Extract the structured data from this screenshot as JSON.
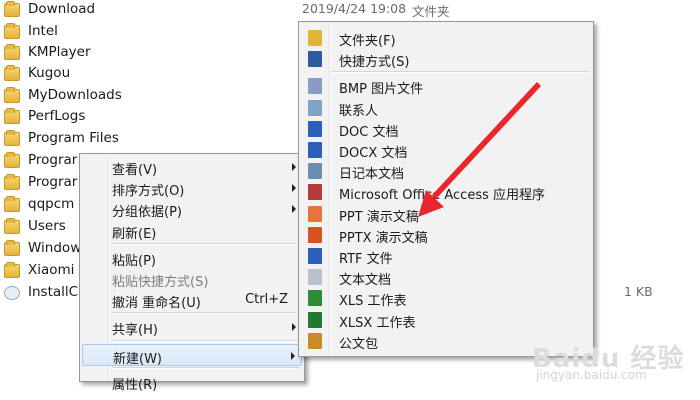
{
  "files": [
    {
      "name": "Download",
      "date": "2019/4/24 19:08",
      "type": "文件夹",
      "size": "",
      "icon": "folder-icon"
    },
    {
      "name": "Intel",
      "date": "",
      "type": "",
      "size": "",
      "icon": "folder-icon"
    },
    {
      "name": "KMPlayer",
      "date": "",
      "type": "",
      "size": "",
      "icon": "folder-icon"
    },
    {
      "name": "Kugou",
      "date": "",
      "type": "",
      "size": "",
      "icon": "folder-icon"
    },
    {
      "name": "MyDownloads",
      "date": "",
      "type": "",
      "size": "",
      "icon": "folder-icon"
    },
    {
      "name": "PerfLogs",
      "date": "",
      "type": "",
      "size": "",
      "icon": "folder-icon"
    },
    {
      "name": "Program Files",
      "date": "",
      "type": "",
      "size": "",
      "icon": "folder-icon"
    },
    {
      "name": "Prograr",
      "date": "",
      "type": "",
      "size": "",
      "icon": "folder-icon"
    },
    {
      "name": "Prograr",
      "date": "",
      "type": "",
      "size": "",
      "icon": "folder-icon"
    },
    {
      "name": "qqpcm",
      "date": "",
      "type": "",
      "size": "",
      "icon": "folder-icon"
    },
    {
      "name": "Users",
      "date": "",
      "type": "",
      "size": "",
      "icon": "folder-icon"
    },
    {
      "name": "Window",
      "date": "",
      "type": "",
      "size": "",
      "icon": "folder-icon"
    },
    {
      "name": "Xiaomi",
      "date": "",
      "type": "",
      "size": "",
      "icon": "folder-icon"
    },
    {
      "name": "InstallC",
      "date": "",
      "type": "",
      "size": "1 KB",
      "icon": "installer-file-icon"
    }
  ],
  "context_menu": {
    "items": [
      {
        "label": "查看(V)",
        "submenu": true
      },
      {
        "label": "排序方式(O)",
        "submenu": true
      },
      {
        "label": "分组依据(P)",
        "submenu": true
      },
      {
        "label": "刷新(E)"
      },
      {
        "separator": true
      },
      {
        "label": "粘贴(P)"
      },
      {
        "label": "粘贴快捷方式(S)",
        "disabled": true
      },
      {
        "label": "撤消 重命名(U)",
        "shortcut": "Ctrl+Z"
      },
      {
        "separator": true
      },
      {
        "label": "共享(H)",
        "submenu": true
      },
      {
        "separator": true
      },
      {
        "label": "新建(W)",
        "submenu": true,
        "highlighted": true
      },
      {
        "separator": true
      },
      {
        "label": "属性(R)"
      }
    ]
  },
  "new_submenu": {
    "items": [
      {
        "label": "文件夹(F)",
        "icon": "folder-icon",
        "color": "#e3b33b"
      },
      {
        "label": "快捷方式(S)",
        "icon": "shortcut-icon",
        "color": "#2f5a9e"
      },
      {
        "separator": true
      },
      {
        "label": "BMP 图片文件",
        "icon": "bmp-image-icon",
        "color": "#8a9bc4"
      },
      {
        "label": "联系人",
        "icon": "contact-icon",
        "color": "#7fa3c9"
      },
      {
        "label": "DOC 文档",
        "icon": "word-doc-icon",
        "color": "#2b5fb8"
      },
      {
        "label": "DOCX 文档",
        "icon": "word-docx-icon",
        "color": "#2b5fb8"
      },
      {
        "label": "日记本文档",
        "icon": "journal-icon",
        "color": "#6a8fb5"
      },
      {
        "label": "Microsoft Office Access 应用程序",
        "icon": "access-icon",
        "color": "#b33a3a"
      },
      {
        "label": "PPT 演示文稿",
        "icon": "ppt-icon",
        "color": "#e8743b"
      },
      {
        "label": "PPTX 演示文稿",
        "icon": "pptx-icon",
        "color": "#d9531e"
      },
      {
        "label": "RTF 文件",
        "icon": "rtf-icon",
        "color": "#2b5fb8"
      },
      {
        "label": "文本文档",
        "icon": "text-doc-icon",
        "color": "#b8c2cf"
      },
      {
        "label": "XLS 工作表",
        "icon": "xls-icon",
        "color": "#2e8b3a"
      },
      {
        "label": "XLSX 工作表",
        "icon": "xlsx-icon",
        "color": "#1f7a2c"
      },
      {
        "label": "公文包",
        "icon": "briefcase-icon",
        "color": "#c98a2c"
      }
    ]
  },
  "watermark": {
    "brand": "Baidu 经验",
    "url": "jingyan.baidu.com"
  },
  "annotation_color": "#e8262b"
}
